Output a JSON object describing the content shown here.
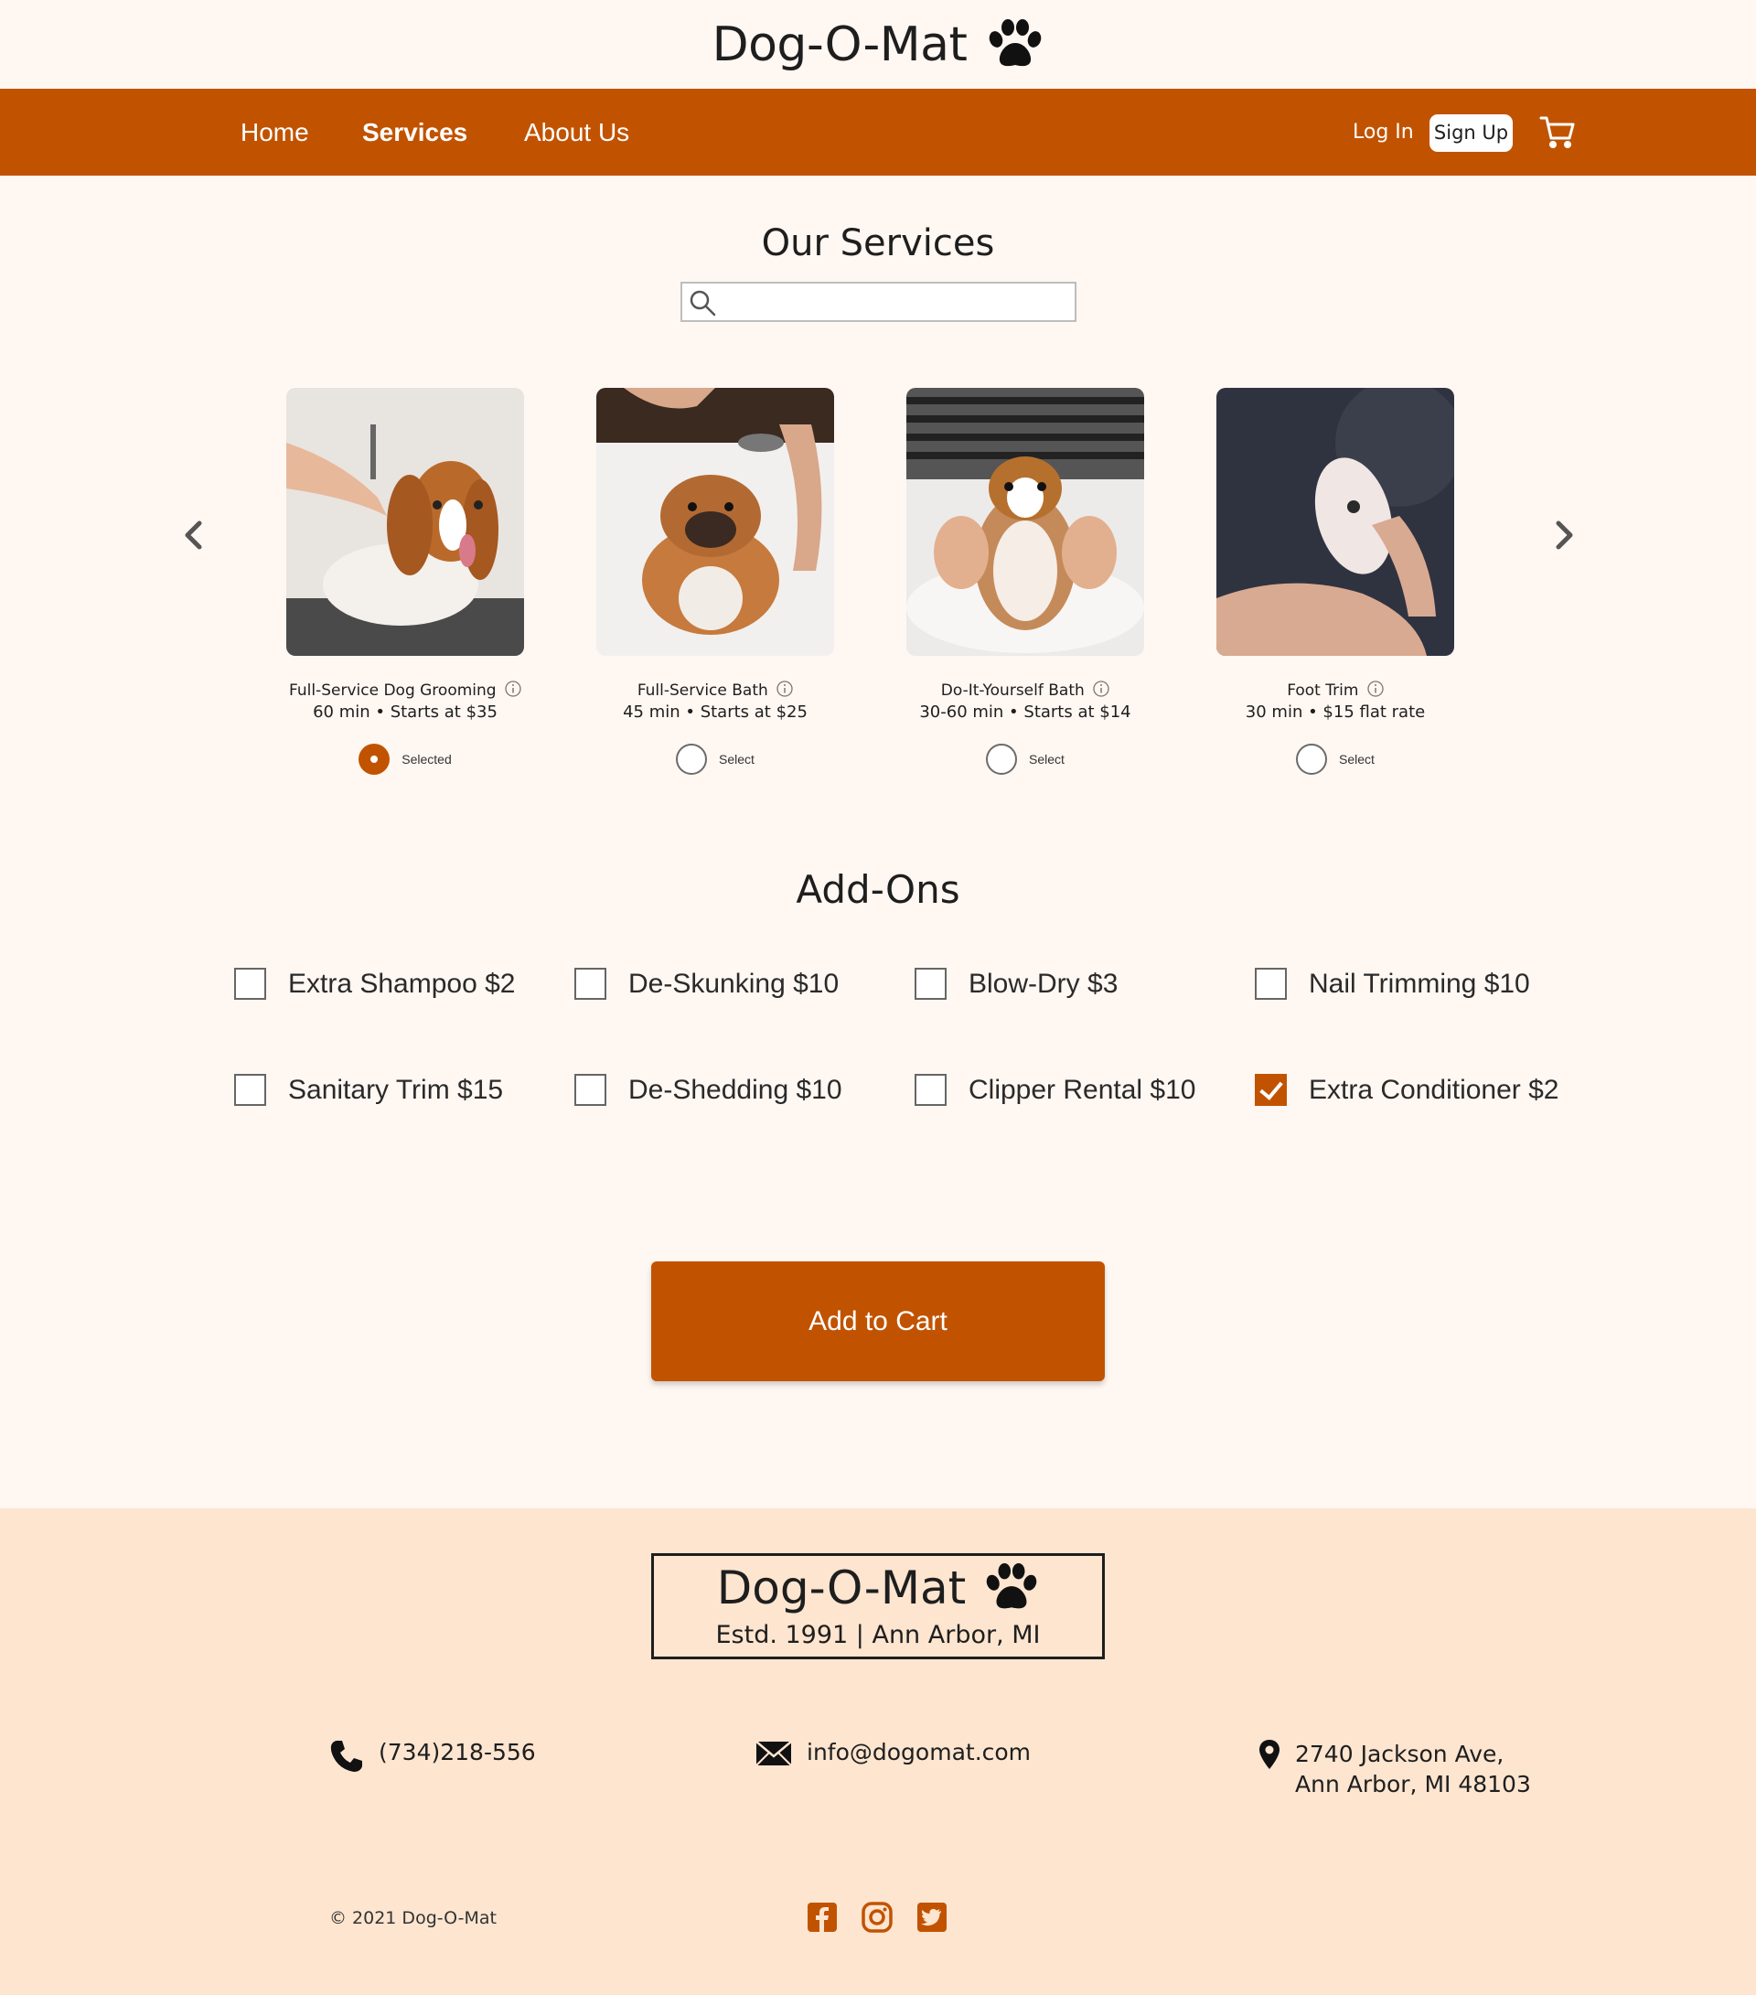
{
  "brand": {
    "name": "Dog-O-Mat",
    "icon": "paw-icon"
  },
  "nav": {
    "links": [
      {
        "label": "Home",
        "active": false
      },
      {
        "label": "Services",
        "active": true
      },
      {
        "label": "About Us",
        "active": false
      }
    ],
    "login": "Log In",
    "signup": "Sign Up",
    "cart_icon": "cart-icon"
  },
  "services": {
    "title": "Our Services",
    "search": {
      "placeholder": "",
      "value": "",
      "icon": "search-icon"
    },
    "items": [
      {
        "name": "Full-Service Dog Grooming",
        "meta": "60 min  •  Starts at $35",
        "select_label": "Selected",
        "selected": true
      },
      {
        "name": "Full-Service Bath",
        "meta": "45 min  •  Starts at $25",
        "select_label": "Select",
        "selected": false
      },
      {
        "name": "Do-It-Yourself Bath",
        "meta": "30-60 min  •  Starts at $14",
        "select_label": "Select",
        "selected": false
      },
      {
        "name": "Foot Trim",
        "meta": "30 min  •  $15 flat rate",
        "select_label": "Select",
        "selected": false
      }
    ]
  },
  "addons": {
    "title": "Add-Ons",
    "items": [
      {
        "label": "Extra Shampoo $2",
        "checked": false
      },
      {
        "label": "De-Skunking $10",
        "checked": false
      },
      {
        "label": "Blow-Dry $3",
        "checked": false
      },
      {
        "label": "Nail Trimming $10",
        "checked": false
      },
      {
        "label": "Sanitary Trim $15",
        "checked": false
      },
      {
        "label": "De-Shedding $10",
        "checked": false
      },
      {
        "label": "Clipper Rental $10",
        "checked": false
      },
      {
        "label": "Extra Conditioner $2",
        "checked": true
      }
    ]
  },
  "add_to_cart": "Add to Cart",
  "footer": {
    "brand": "Dog-O-Mat",
    "tagline": "Estd. 1991  |  Ann Arbor, MI",
    "phone": "(734)218-556",
    "email": "info@dogomat.com",
    "address_line1": "2740 Jackson Ave,",
    "address_line2": "Ann Arbor, MI 48103",
    "copyright": "© 2021 Dog-O-Mat",
    "social": [
      "facebook-icon",
      "instagram-icon",
      "twitter-icon"
    ]
  },
  "colors": {
    "accent": "#C15300",
    "background": "#FFF7F2",
    "footer_bg": "#FDE5D0"
  }
}
